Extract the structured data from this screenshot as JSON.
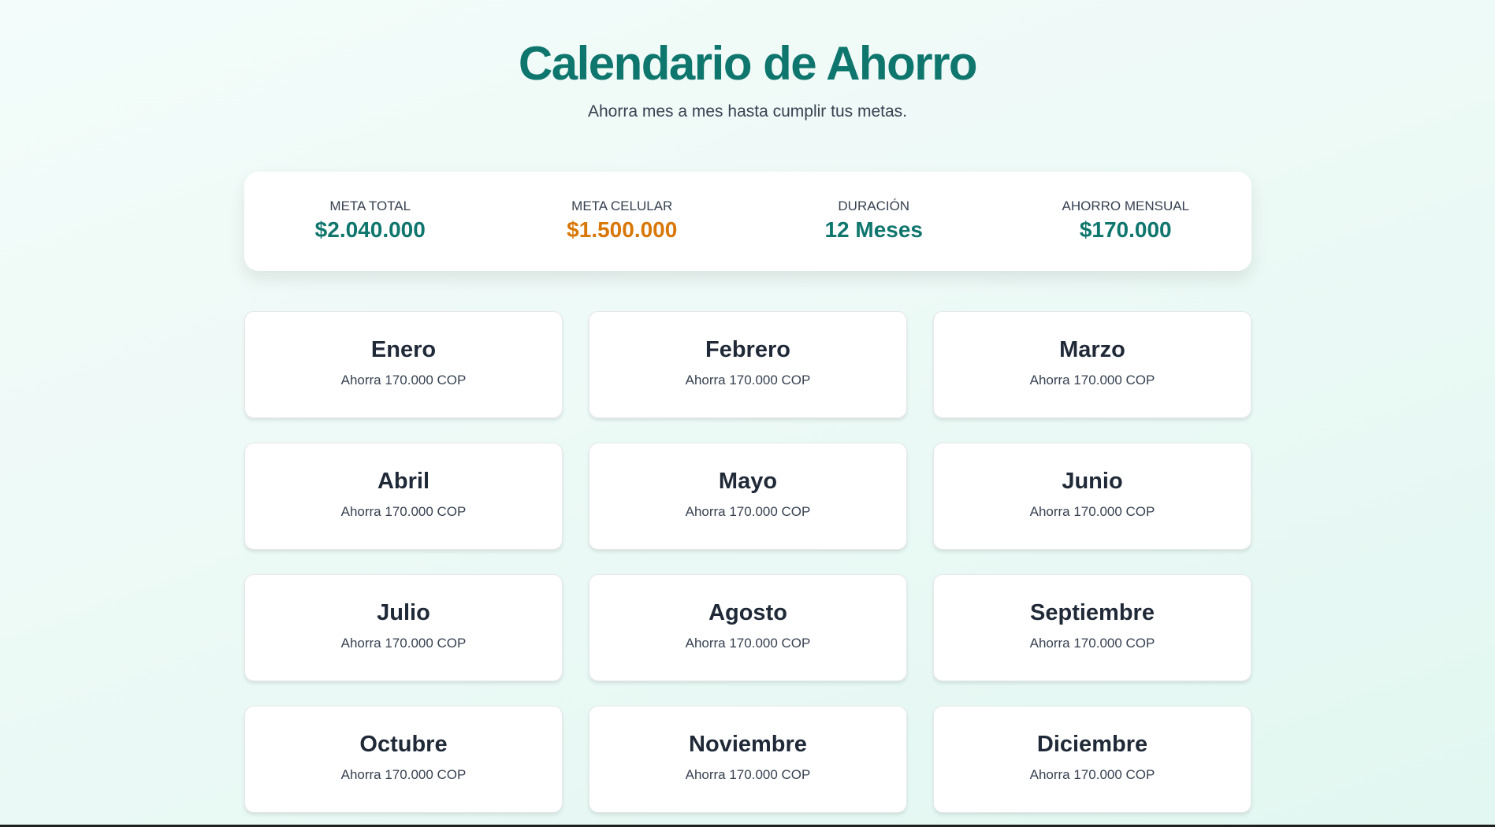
{
  "header": {
    "title": "Calendario de Ahorro",
    "subtitle": "Ahorra mes a mes hasta cumplir tus metas."
  },
  "stats": [
    {
      "label": "Meta Total",
      "value": "$2.040.000"
    },
    {
      "label": "Meta Celular",
      "value": "$1.500.000"
    },
    {
      "label": "Duración",
      "value": "12 Meses"
    },
    {
      "label": "Ahorro Mensual",
      "value": "$170.000"
    }
  ],
  "colors": {
    "primary": "#0f766e",
    "accent": "#d97706"
  },
  "months": [
    {
      "name": "Enero",
      "amount": "Ahorra 170.000 COP"
    },
    {
      "name": "Febrero",
      "amount": "Ahorra 170.000 COP"
    },
    {
      "name": "Marzo",
      "amount": "Ahorra 170.000 COP"
    },
    {
      "name": "Abril",
      "amount": "Ahorra 170.000 COP"
    },
    {
      "name": "Mayo",
      "amount": "Ahorra 170.000 COP"
    },
    {
      "name": "Junio",
      "amount": "Ahorra 170.000 COP"
    },
    {
      "name": "Julio",
      "amount": "Ahorra 170.000 COP"
    },
    {
      "name": "Agosto",
      "amount": "Ahorra 170.000 COP"
    },
    {
      "name": "Septiembre",
      "amount": "Ahorra 170.000 COP"
    },
    {
      "name": "Octubre",
      "amount": "Ahorra 170.000 COP"
    },
    {
      "name": "Noviembre",
      "amount": "Ahorra 170.000 COP"
    },
    {
      "name": "Diciembre",
      "amount": "Ahorra 170.000 COP"
    }
  ]
}
